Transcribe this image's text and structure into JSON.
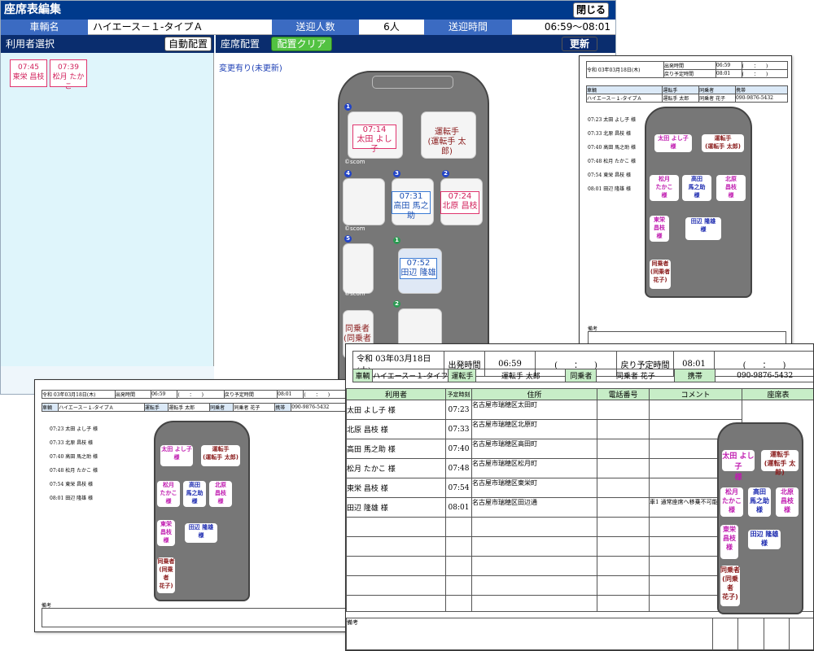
{
  "app": {
    "title": "座席表編集",
    "close_label": "閉じる",
    "vehicle_label": "車輌名",
    "vehicle_value": "ハイエース－１-タイプＡ",
    "count_label": "送迎人数",
    "count_value": "6人",
    "time_label": "送迎時間",
    "time_value": "06:59～08:01",
    "user_select_label": "利用者選択",
    "auto_button": "自動配置",
    "seat_label": "座席配置",
    "clear_button": "配置クリア",
    "update_button": "更新",
    "changed_text": "変更有り(未更新)"
  },
  "unassigned": [
    {
      "time": "07:45",
      "name": "東栄 昌枝"
    },
    {
      "time": "07:39",
      "name": "松月 たかこ"
    }
  ],
  "editor_seats": {
    "s1_time": "07:14",
    "s1_name": "太田 よし子",
    "driver": "運転手\n(運転手 太郎)",
    "s3_time": "07:31",
    "s3_name": "高田 馬之助",
    "s2_time": "07:24",
    "s2_name": "北原 昌枝",
    "wc_time": "07:52",
    "wc_name": "田辺 隆雄",
    "companion": "同乗者\n(同乗者 花",
    "badges": [
      "1",
      "4",
      "3",
      "2",
      "5",
      "1",
      "2"
    ],
    "logo": "©scom"
  },
  "sheet": {
    "date": "令和 03年03月18日(木)",
    "dep_label": "出発時間",
    "dep_value": "06:59",
    "paren_value": "(　　：　　)",
    "ret_label": "戻り予定時間",
    "ret_value": "08:01",
    "vehicle_label": "車輌",
    "vehicle_value": "ハイエース－１-タイプＡ",
    "vehicle_value_short": "ハイエース－１-タイフ",
    "driver_label": "運転手",
    "driver_value": "運転手 太郎",
    "companion_label": "同乗者",
    "companion_value": "同乗者 花子",
    "phone_label": "携帯",
    "phone_value": "090-9876-5432",
    "notes_label": "備考",
    "headers": [
      "利用者",
      "予定時刻",
      "住所",
      "電話番号",
      "コメント",
      "座席表"
    ],
    "rows": [
      {
        "name": "太田 よし子 様",
        "time": "07:23",
        "addr": "名古屋市瑞穂区太田町",
        "comment": ""
      },
      {
        "name": "北原 昌枝 様",
        "time": "07:33",
        "addr": "名古屋市瑞穂区北原町",
        "comment": ""
      },
      {
        "name": "高田 馬之助 様",
        "time": "07:40",
        "addr": "名古屋市瑞穂区高田町",
        "comment": ""
      },
      {
        "name": "松月 たかこ 様",
        "time": "07:48",
        "addr": "名古屋市瑞穂区松月町",
        "comment": ""
      },
      {
        "name": "東栄 昌枝 様",
        "time": "07:54",
        "addr": "名古屋市瑞穂区東栄町",
        "comment": ""
      },
      {
        "name": "田辺 隆雄 様",
        "time": "08:01",
        "addr": "名古屋市瑞穂区田辺通",
        "comment": "車1 通常座席へ移乗不可能"
      }
    ],
    "seat_cards": {
      "ota": "太田 よし子\n様",
      "driver": "運転手\n(運転手 太郎)",
      "matsu": "松月\nたかこ\n様",
      "takada": "高田\n馬之助\n様",
      "kita": "北原\n昌枝\n様",
      "tou": "東栄\n昌枝\n様",
      "tanabe": "田辺 隆雄\n様",
      "comp": "同乗者\n(同乗者\n花子)"
    }
  }
}
